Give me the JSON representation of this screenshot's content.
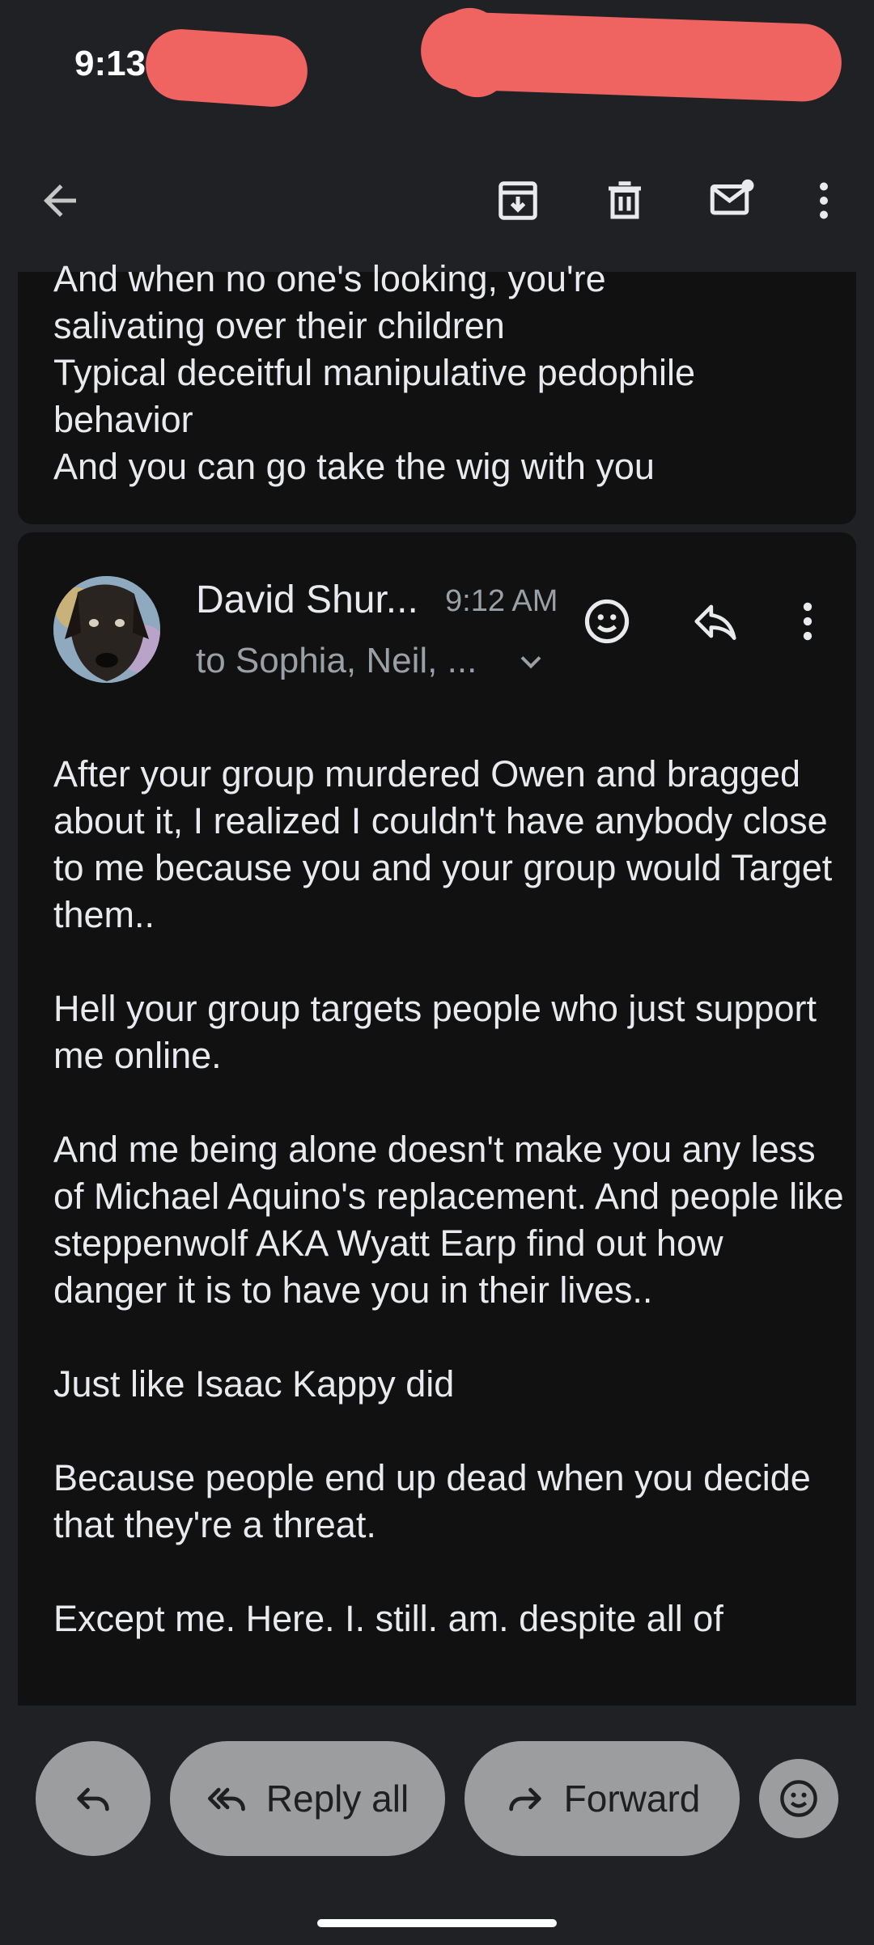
{
  "status_bar": {
    "time": "9:13"
  },
  "toolbar": {
    "icons": [
      "back-arrow-icon",
      "archive-icon",
      "delete-icon",
      "mark-unread-icon",
      "more-vert-icon"
    ]
  },
  "previous_message": {
    "lines": [
      "And when no one's looking, you're",
      "salivating over their children",
      "Typical deceitful manipulative pedophile",
      "behavior",
      "And you can go take the wig with you"
    ]
  },
  "message": {
    "sender": "David Shur...",
    "time": "9:12 AM",
    "recipients": "to Sophia, Neil, ...",
    "paragraphs": [
      "After your group murdered Owen and bragged about it, I realized I couldn't have anybody close to me because you and your group would Target them..",
      "Hell your group targets people who just support me online.",
      "And me being alone doesn't make you any less of Michael Aquino's replacement. And people like steppenwolf AKA Wyatt Earp find out how danger it is to have you in their lives..",
      "Just like Isaac Kappy did",
      "Because people end up dead when you decide that they're a threat.",
      "Except me. Here. I. still. am. despite all of"
    ]
  },
  "actions": {
    "reply_all": "Reply all",
    "forward": "Forward"
  },
  "colors": {
    "background": "#202124",
    "card": "#111111",
    "pill": "#9b9d9f",
    "redaction": "#ef6461"
  }
}
